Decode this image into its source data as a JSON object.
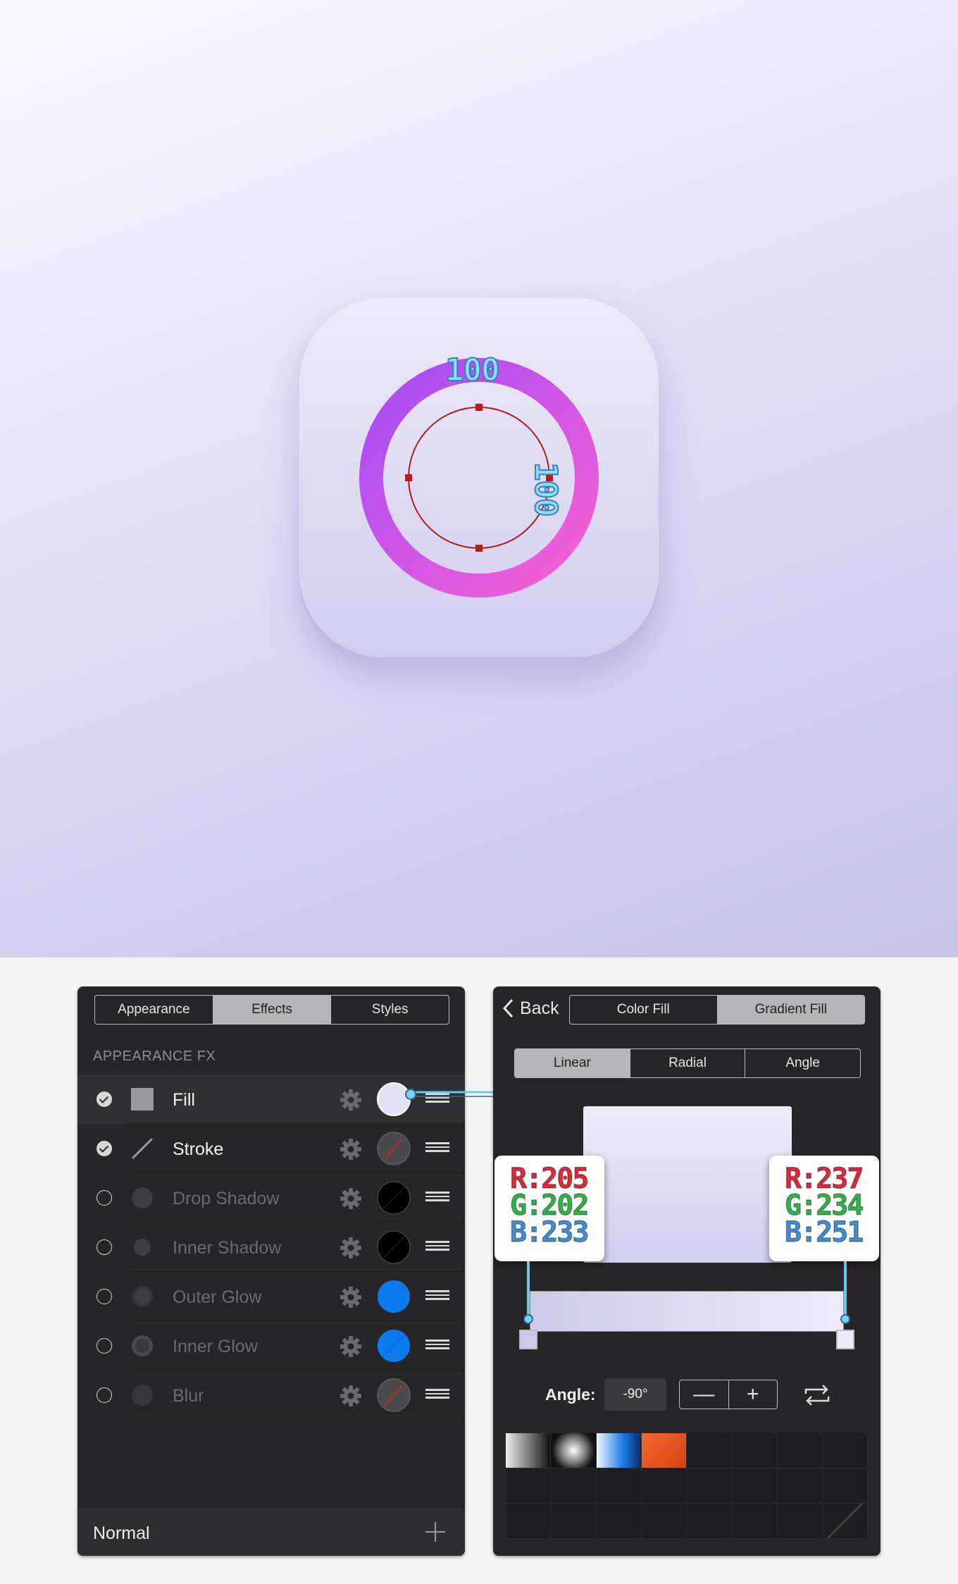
{
  "canvas": {
    "ring_dimension_top": "100",
    "ring_dimension_right": "100",
    "ring_gradient": [
      "#a84ff5",
      "#f560d8"
    ]
  },
  "appearance_panel": {
    "tabs": [
      {
        "label": "Appearance",
        "active": false
      },
      {
        "label": "Effects",
        "active": true
      },
      {
        "label": "Styles",
        "active": false
      }
    ],
    "section_title": "APPEARANCE FX",
    "effects": [
      {
        "label": "Fill",
        "enabled": true,
        "icon": "fill-square-icon",
        "swatch": "light-lavender"
      },
      {
        "label": "Stroke",
        "enabled": true,
        "icon": "stroke-line-icon",
        "swatch": "none"
      },
      {
        "label": "Drop Shadow",
        "enabled": false,
        "icon": "drop-shadow-icon",
        "swatch": "black"
      },
      {
        "label": "Inner Shadow",
        "enabled": false,
        "icon": "inner-shadow-icon",
        "swatch": "black"
      },
      {
        "label": "Outer Glow",
        "enabled": false,
        "icon": "outer-glow-icon",
        "swatch": "blue"
      },
      {
        "label": "Inner Glow",
        "enabled": false,
        "icon": "inner-glow-icon",
        "swatch": "blue"
      },
      {
        "label": "Blur",
        "enabled": false,
        "icon": "blur-icon",
        "swatch": "none"
      }
    ],
    "blend_mode": "Normal"
  },
  "gradient_panel": {
    "back_label": "Back",
    "fill_tabs": [
      {
        "label": "Color Fill",
        "active": false
      },
      {
        "label": "Gradient Fill",
        "active": true
      }
    ],
    "type_tabs": [
      {
        "label": "Linear",
        "active": true
      },
      {
        "label": "Radial",
        "active": false
      },
      {
        "label": "Angle",
        "active": false
      }
    ],
    "stop_left": {
      "r": "R:205",
      "g": "G:202",
      "b": "B:233",
      "color": "#cdcae9"
    },
    "stop_right": {
      "r": "R:237",
      "g": "G:234",
      "b": "B:251",
      "color": "#edeafb"
    },
    "angle_label": "Angle:",
    "angle_value": "-90°",
    "stepper_minus": "—",
    "stepper_plus": "+"
  }
}
